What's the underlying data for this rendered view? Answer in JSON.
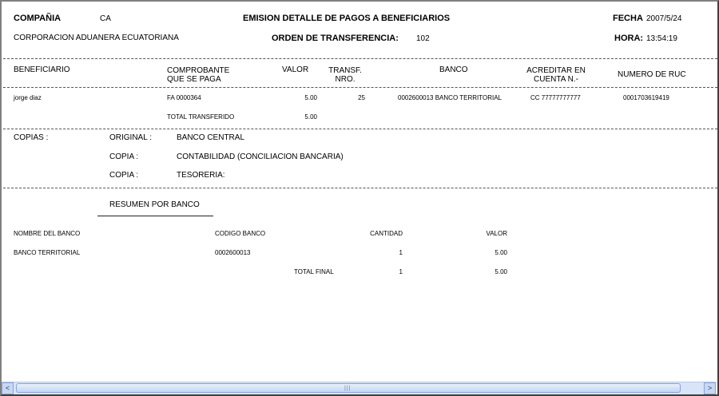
{
  "header": {
    "company_label": "COMPAÑIA",
    "company_value": "CA",
    "title": "EMISION DETALLE DE PAGOS A BENEFICIARIOS",
    "date_label": "FECHA",
    "date_value": "2007/5/24",
    "company_name": "CORPORACION ADUANERA ECUATORIANA",
    "transfer_label": "ORDEN DE TRANSFERENCIA:",
    "transfer_value": "102",
    "time_label": "HORA:",
    "time_value": "13:54:19"
  },
  "columns": {
    "beneficiario": "BENEFICIARIO",
    "comprobante_1": "COMPROBANTE",
    "comprobante_2": "QUE SE PAGA",
    "valor": "VALOR",
    "transf_1": "TRANSF.",
    "transf_2": "NRO.",
    "banco": "BANCO",
    "acreditar_1": "ACREDITAR EN",
    "acreditar_2": "CUENTA N.-",
    "ruc": "NUMERO DE RUC"
  },
  "rows": [
    {
      "beneficiario": "jorge diaz",
      "comprobante": "FA 0000364",
      "valor": "5.00",
      "transf": "25",
      "banco": "0002600013 BANCO TERRITORIAL",
      "cuenta": "CC 77777777777",
      "ruc": "0001703619419"
    }
  ],
  "total_transferido": {
    "label": "TOTAL TRANSFERIDO",
    "value": "5.00"
  },
  "copias": {
    "label": "COPIAS :",
    "items": [
      {
        "label": "ORIGINAL :",
        "value": "BANCO CENTRAL"
      },
      {
        "label": "COPIA :",
        "value": "CONTABILIDAD (CONCILIACION BANCARIA)"
      },
      {
        "label": "COPIA :",
        "value": "TESORERIA:"
      }
    ]
  },
  "resumen": {
    "title": "RESUMEN POR BANCO",
    "headers": {
      "nombre": "NOMBRE DEL BANCO",
      "codigo": "CODIGO BANCO",
      "cantidad": "CANTIDAD",
      "valor": "VALOR"
    },
    "rows": [
      {
        "nombre": "BANCO TERRITORIAL",
        "codigo": "0002600013",
        "cantidad": "1",
        "valor": "5.00"
      }
    ],
    "total": {
      "label": "TOTAL FINAL",
      "cantidad": "1",
      "valor": "5.00"
    }
  },
  "scrollbar": {
    "left_arrow": "<",
    "right_arrow": ">",
    "grip": "|||"
  }
}
